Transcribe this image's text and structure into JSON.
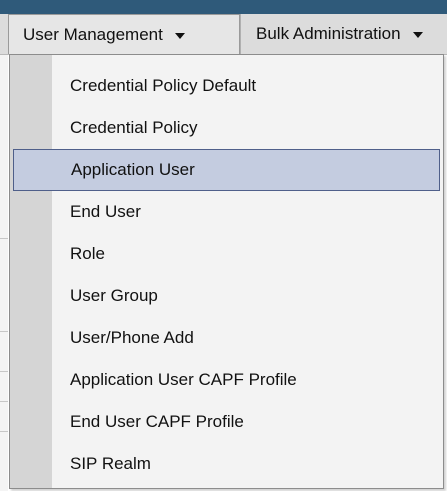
{
  "menubar": {
    "tabs": [
      {
        "label": "User Management"
      },
      {
        "label": "Bulk Administration"
      }
    ]
  },
  "dropdown": {
    "selected_index": 2,
    "items": [
      {
        "label": "Credential Policy Default"
      },
      {
        "label": "Credential Policy"
      },
      {
        "label": "Application User"
      },
      {
        "label": "End User"
      },
      {
        "label": "Role"
      },
      {
        "label": "User Group"
      },
      {
        "label": "User/Phone Add"
      },
      {
        "label": "Application User CAPF Profile"
      },
      {
        "label": "End User CAPF Profile"
      },
      {
        "label": "SIP Realm"
      }
    ]
  },
  "colors": {
    "header_bar": "#2f5a7a",
    "selected_bg": "#c4cce0",
    "selected_border": "#4f5f8a"
  },
  "icons": {
    "dropdown_caret": "caret-down-icon"
  }
}
